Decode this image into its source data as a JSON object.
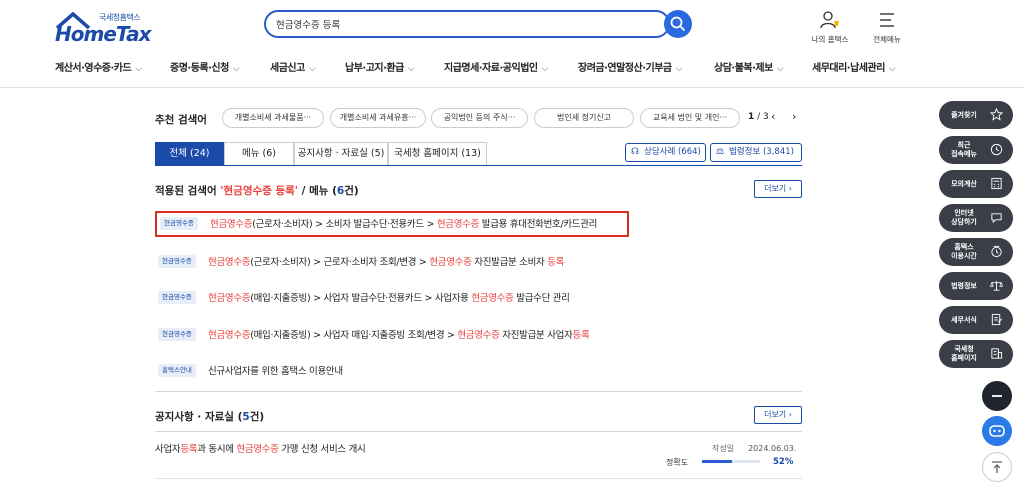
{
  "header": {
    "logo_sub": "국세청홈택스",
    "logo_main": "HomeTax",
    "search_value": "현금영수증 등록",
    "my_hometax": "나의 홈택스",
    "all_menu": "전체메뉴"
  },
  "nav": {
    "items": [
      "계산서·영수증·카드",
      "증명·등록·신청",
      "세금신고",
      "납부·고지·환급",
      "지급명세·자료·공익법인",
      "장려금·연말정산·기부금",
      "상담·불복·제보",
      "세무대리·납세관리"
    ]
  },
  "recommend": {
    "title": "추천 검색어",
    "chips": [
      "개별소비세 과세물품···",
      "개별소비세 과세유흥···",
      "공익법인 등의 주식···",
      "법인세 정기신고",
      "교육세 법인 및 개인···"
    ],
    "page_current": "1",
    "page_total": " / 3"
  },
  "tabs": [
    {
      "label": "전체 (24)"
    },
    {
      "label": "메뉴 (6)"
    },
    {
      "label": "공지사항 · 자료실 (5)"
    },
    {
      "label": "국세청 홈페이지 (13)"
    }
  ],
  "side_buttons": {
    "consult": "상담사례 (664)",
    "law": "법령정보 (3,841)"
  },
  "menu_section": {
    "prefix": "적용된 검색어 ",
    "keyword": "'현금영수증 등록'",
    "middle": " / 메뉴 (",
    "count": "6",
    "suffix": "건)",
    "more": "더보기 ›"
  },
  "results": [
    {
      "badge": "현금영수증",
      "hl1": "현금영수증",
      "t1": "(근로자·소비자) > 소비자 발급수단·전용카드 > ",
      "hl2": "현금영수증",
      "t2": " 발급용 휴대전화번호/카드관리",
      "hl3": "",
      "t3": ""
    },
    {
      "badge": "현금영수증",
      "hl1": "현금영수증",
      "t1": "(근로자·소비자) > 근로자·소비자 조회/변경 > ",
      "hl2": "현금영수증",
      "t2": " 자진발급분 소비자 ",
      "hl3": "등록",
      "t3": ""
    },
    {
      "badge": "현금영수증",
      "hl1": "현금영수증",
      "t1": "(매입·지출증빙) > 사업자 발급수단·전용카드 > 사업자용 ",
      "hl2": "현금영수증",
      "t2": " 발급수단 관리",
      "hl3": "",
      "t3": ""
    },
    {
      "badge": "현금영수증",
      "hl1": "현금영수증",
      "t1": "(매입·지출증빙) > 사업자 매입·지출증빙 조회/변경 > ",
      "hl2": "현금영수증",
      "t2": " 자진발급분 사업자",
      "hl3": "등록",
      "t3": ""
    },
    {
      "badge": "홈택스안내",
      "hl1": "",
      "t1": "신규사업자를 위한 홈택스 이용안내",
      "hl2": "",
      "t2": "",
      "hl3": "",
      "t3": ""
    }
  ],
  "notice_section": {
    "title": "공지사항 · 자료실 (",
    "count": "5",
    "suffix": "건)",
    "more": "더보기 ›",
    "item_a": "사업자",
    "item_hl1": "등록",
    "item_b": "과 동시에 ",
    "item_hl2": "현금영수증",
    "item_c": " 가맹 신청 서비스 개시",
    "date_label": "작성일",
    "date": "2024.06.03.",
    "accuracy_label": "정확도",
    "accuracy": "52%",
    "accuracy_value": 0.52
  },
  "quick_menu": [
    {
      "label": "즐겨찾기",
      "icon": "star-icon"
    },
    {
      "label": "최근\n접속메뉴",
      "icon": "clock-icon"
    },
    {
      "label": "모의계산",
      "icon": "calculator-icon"
    },
    {
      "label": "인터넷\n상담하기",
      "icon": "chat-icon"
    },
    {
      "label": "홈택스\n이용시간",
      "icon": "time-icon"
    },
    {
      "label": "법령정보",
      "icon": "law-icon"
    },
    {
      "label": "세무서식",
      "icon": "form-icon"
    },
    {
      "label": "국세청\n홈페이지",
      "icon": "building-icon"
    }
  ],
  "colors": {
    "brand": "#1a4ba8",
    "highlight": "#e8403c",
    "quick_menu": "#3a3f47"
  }
}
